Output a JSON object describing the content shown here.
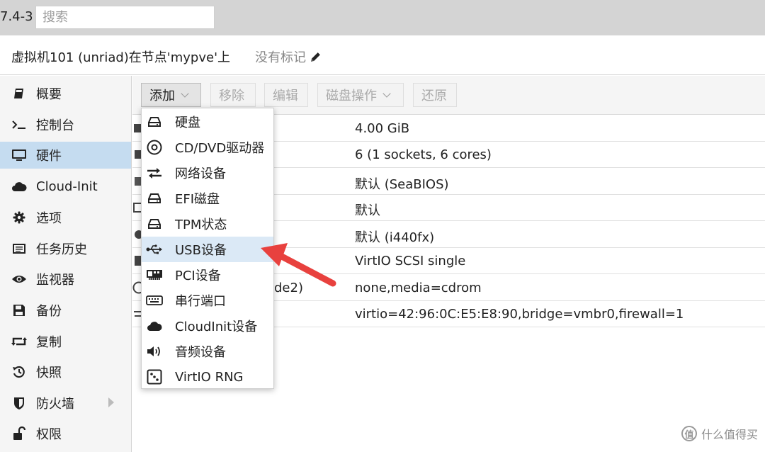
{
  "header": {
    "version": "7.4-3",
    "search_placeholder": "搜索"
  },
  "title": {
    "vm_label": "虚拟机101 (unriad)在节点'mypve'上",
    "tags_label": "没有标记"
  },
  "sidebar": {
    "items": [
      {
        "label": "概要",
        "icon": "book-icon"
      },
      {
        "label": "控制台",
        "icon": "terminal-icon"
      },
      {
        "label": "硬件",
        "icon": "monitor-icon",
        "active": true
      },
      {
        "label": "Cloud-Init",
        "icon": "cloud-icon"
      },
      {
        "label": "选项",
        "icon": "gear-icon"
      },
      {
        "label": "任务历史",
        "icon": "list-icon"
      },
      {
        "label": "监视器",
        "icon": "eye-icon"
      },
      {
        "label": "备份",
        "icon": "floppy-icon"
      },
      {
        "label": "复制",
        "icon": "retweet-icon"
      },
      {
        "label": "快照",
        "icon": "history-icon"
      },
      {
        "label": "防火墙",
        "icon": "shield-icon",
        "has_submenu": true
      },
      {
        "label": "权限",
        "icon": "unlock-icon"
      }
    ]
  },
  "toolbar": {
    "add_label": "添加",
    "remove_label": "移除",
    "edit_label": "编辑",
    "disk_action_label": "磁盘操作",
    "revert_label": "还原"
  },
  "hardware": {
    "rows": [
      {
        "name": "",
        "value": "4.00 GiB"
      },
      {
        "name": "",
        "value": "6 (1 sockets, 6 cores)"
      },
      {
        "name": "",
        "value": "默认 (SeaBIOS)"
      },
      {
        "name": "",
        "value": "默认"
      },
      {
        "name": "",
        "value": "默认 (i440fx)"
      },
      {
        "name": "",
        "value": "VirtIO SCSI single"
      },
      {
        "name": "de2)",
        "value": "none,media=cdrom"
      },
      {
        "name": "",
        "value": "virtio=42:96:0C:E5:E8:90,bridge=vmbr0,firewall=1"
      }
    ]
  },
  "add_menu": {
    "items": [
      {
        "label": "硬盘",
        "icon": "hdd-icon"
      },
      {
        "label": "CD/DVD驱动器",
        "icon": "cdrom-icon"
      },
      {
        "label": "网络设备",
        "icon": "exchange-icon"
      },
      {
        "label": "EFI磁盘",
        "icon": "hdd-icon"
      },
      {
        "label": "TPM状态",
        "icon": "hdd-icon"
      },
      {
        "label": "USB设备",
        "icon": "usb-icon",
        "highlighted": true
      },
      {
        "label": "PCI设备",
        "icon": "pci-card-icon"
      },
      {
        "label": "串行端口",
        "icon": "keyboard-icon"
      },
      {
        "label": "CloudInit设备",
        "icon": "cloud-icon"
      },
      {
        "label": "音频设备",
        "icon": "volume-icon"
      },
      {
        "label": "VirtIO RNG",
        "icon": "dice-icon"
      }
    ]
  },
  "annotation": {
    "arrow_color": "#e8413e"
  },
  "watermark": {
    "logo_glyph": "值",
    "text": "什么值得买"
  }
}
